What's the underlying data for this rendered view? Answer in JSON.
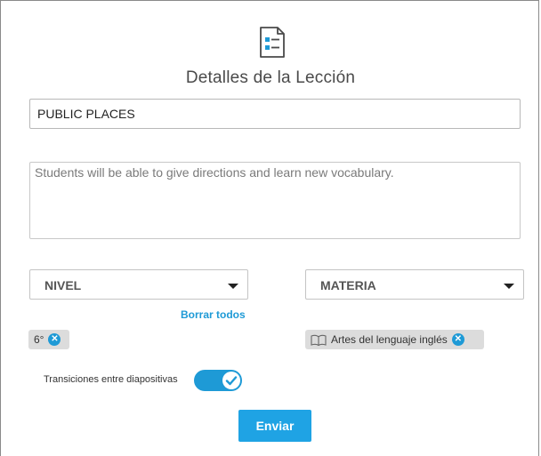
{
  "dialog": {
    "title": "Detalles de la Lección",
    "header_icon": "document-checklist-icon"
  },
  "fields": {
    "title_value": "PUBLIC PLACES",
    "description_value": "Students will be able to give directions and learn new vocabulary."
  },
  "selects": {
    "level_label": "NIVEL",
    "subject_label": "MATERIA"
  },
  "clear_all_label": "Borrar todos",
  "chips": {
    "grade": "6°",
    "subject": "Artes del lenguaje inglés"
  },
  "toggle": {
    "label": "Transiciones entre diapositivas",
    "enabled": true
  },
  "submit_label": "Enviar",
  "colors": {
    "accent": "#1e9ad6",
    "chip_bg": "#dcdcdc"
  }
}
